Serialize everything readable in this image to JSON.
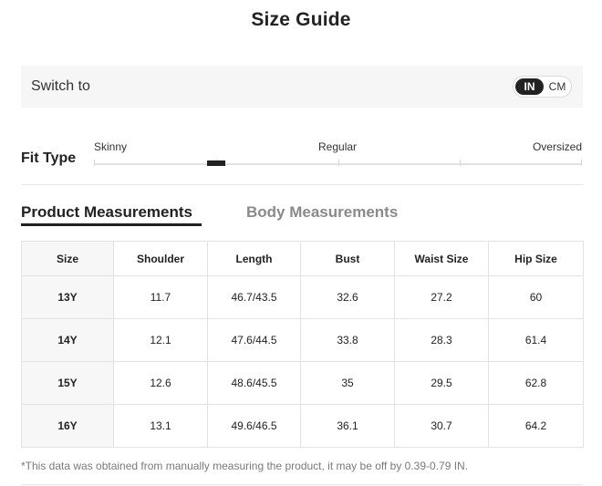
{
  "title": "Size Guide",
  "switch": {
    "label": "Switch to",
    "units": [
      "IN",
      "CM"
    ],
    "selected": "IN"
  },
  "fit": {
    "label": "Fit Type",
    "options": [
      "Skinny",
      "Regular",
      "Oversized"
    ],
    "marker_fraction": 0.25
  },
  "tabs": [
    {
      "label": "Product Measurements",
      "active": true
    },
    {
      "label": "Body Measurements",
      "active": false
    }
  ],
  "table": {
    "headers": [
      "Size",
      "Shoulder",
      "Length",
      "Bust",
      "Waist Size",
      "Hip Size"
    ],
    "rows": [
      [
        "13Y",
        "11.7",
        "46.7/43.5",
        "32.6",
        "27.2",
        "60"
      ],
      [
        "14Y",
        "12.1",
        "47.6/44.5",
        "33.8",
        "28.3",
        "61.4"
      ],
      [
        "15Y",
        "12.6",
        "48.6/45.5",
        "35",
        "29.5",
        "62.8"
      ],
      [
        "16Y",
        "13.1",
        "49.6/46.5",
        "36.1",
        "30.7",
        "64.2"
      ]
    ]
  },
  "note": "*This data was obtained from manually measuring the product, it may be off by 0.39-0.79 IN.",
  "colors": {
    "accent": "#222222",
    "panel": "#f6f6f6",
    "inactive_tab": "#8a8a8a"
  }
}
